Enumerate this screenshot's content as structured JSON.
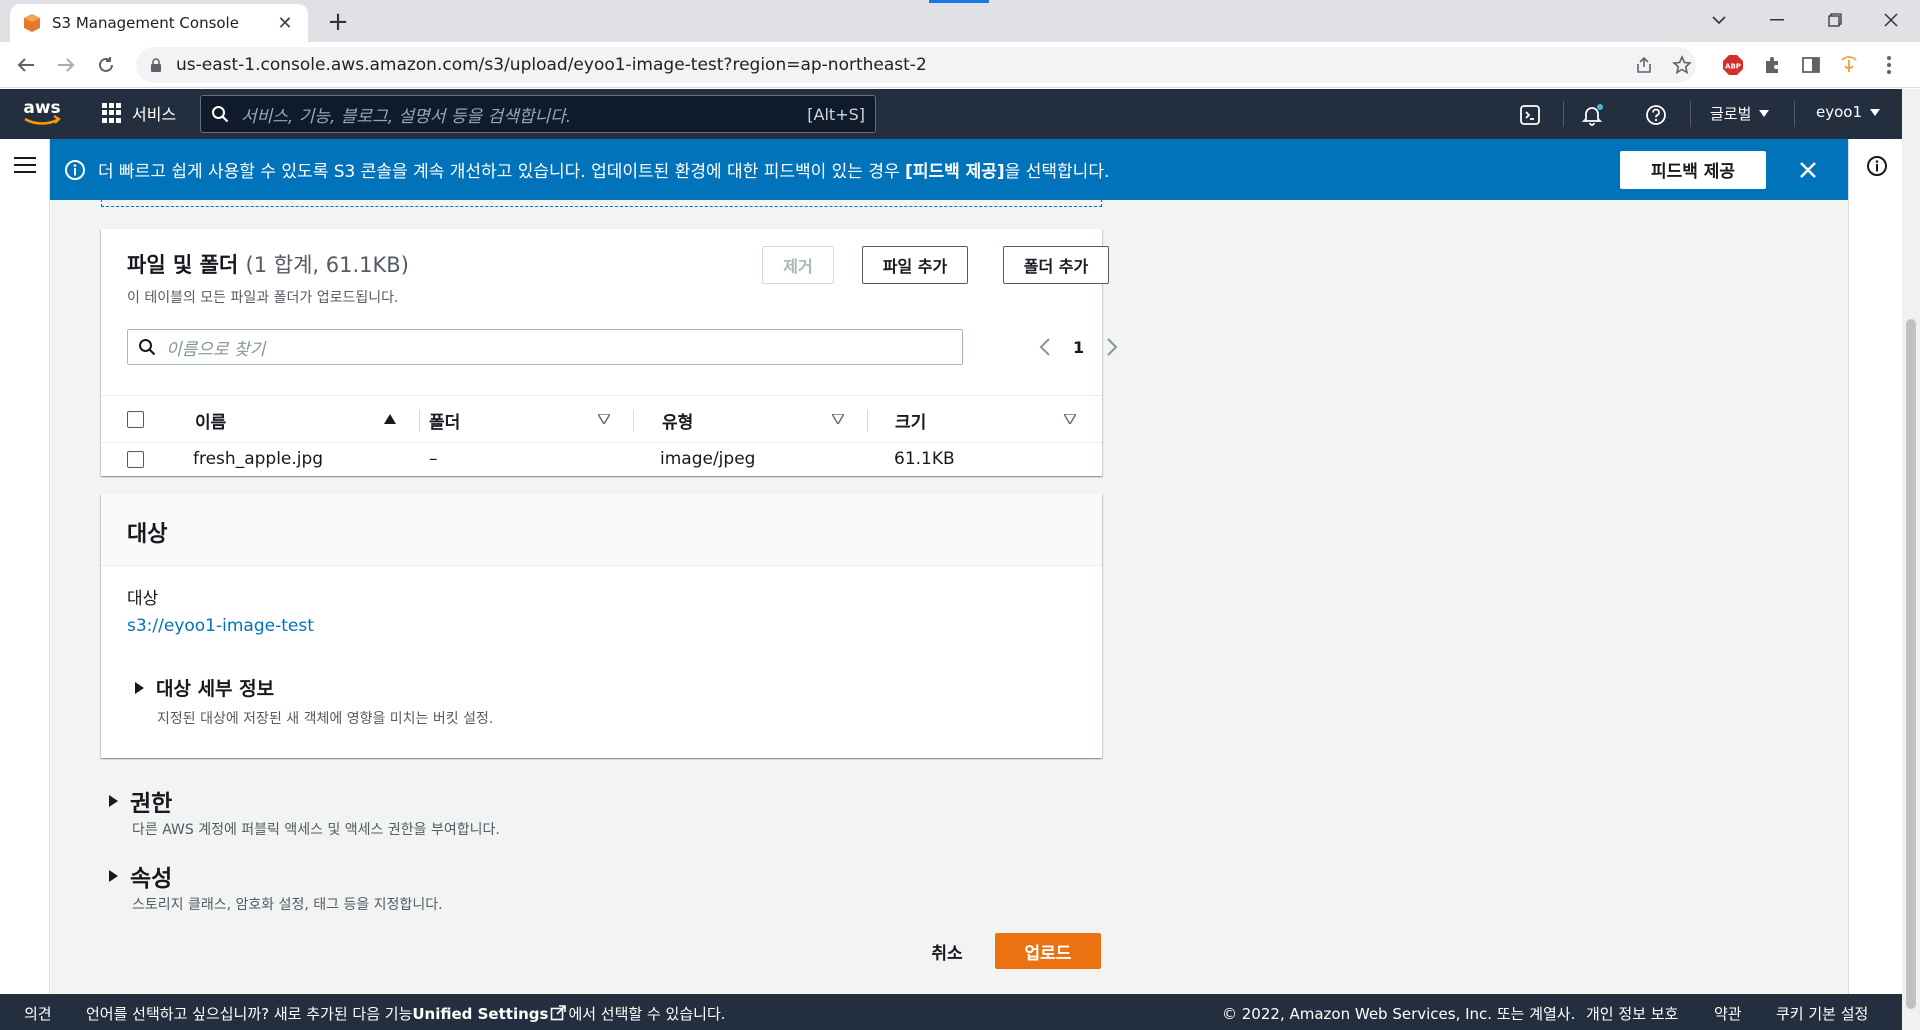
{
  "browser": {
    "tab_title": "S3 Management Console",
    "url": "us-east-1.console.aws.amazon.com/s3/upload/eyoo1-image-test?region=ap-northeast-2"
  },
  "aws_nav": {
    "services_label": "서비스",
    "search_placeholder": "서비스, 기능, 블로그, 설명서 등을 검색합니다.",
    "search_shortcut": "[Alt+S]",
    "region_label": "글로벌",
    "account_label": "eyoo1"
  },
  "banner": {
    "message_prefix": "더 빠르고 쉽게 사용할 수 있도록 S3 콘솔을 계속 개선하고 있습니다. 업데이트된 환경에 대한 피드백이 있는 경우 ",
    "message_bold": "[피드백 제공]",
    "message_suffix": "을 선택합니다.",
    "feedback_button": "피드백 제공"
  },
  "files_panel": {
    "title": "파일 및 폴더",
    "count": "(1 합계, 61.1KB)",
    "description": "이 테이블의 모든 파일과 폴더가 업로드됩니다.",
    "remove_button": "제거",
    "add_files_button": "파일 추가",
    "add_folder_button": "폴더 추가",
    "filter_placeholder": "이름으로 찾기",
    "page_number": "1",
    "columns": [
      "이름",
      "폴더",
      "유형",
      "크기"
    ],
    "rows": [
      {
        "name": "fresh_apple.jpg",
        "folder": "–",
        "type": "image/jpeg",
        "size": "61.1KB"
      }
    ]
  },
  "destination_panel": {
    "title": "대상",
    "label": "대상",
    "link": "s3://eyoo1-image-test",
    "details_title": "대상 세부 정보",
    "details_desc": "지정된 대상에 저장된 새 객체에 영향을 미치는 버킷 설정."
  },
  "permissions": {
    "title": "권한",
    "desc": "다른 AWS 계정에 퍼블릭 액세스 및 액세스 권한을 부여합니다."
  },
  "properties": {
    "title": "속성",
    "desc": "스토리지 클래스, 암호화 설정, 태그 등을 지정합니다."
  },
  "actions": {
    "cancel": "취소",
    "upload": "업로드"
  },
  "footer": {
    "feedback": "의견",
    "language_prefix": "언어를 선택하고 싶으십니까? 새로 추가된 다음 기능",
    "language_link": "Unified Settings",
    "language_suffix": "에서 선택할 수 있습니다.",
    "copyright": "© 2022, Amazon Web Services, Inc. 또는 계열사.",
    "privacy": "개인 정보 보호",
    "terms": "약관",
    "cookies": "쿠키 기본 설정"
  },
  "colors": {
    "aws_nav": "#232f3e",
    "banner": "#0073bb",
    "primary_button": "#ec7211",
    "link": "#0073bb"
  }
}
